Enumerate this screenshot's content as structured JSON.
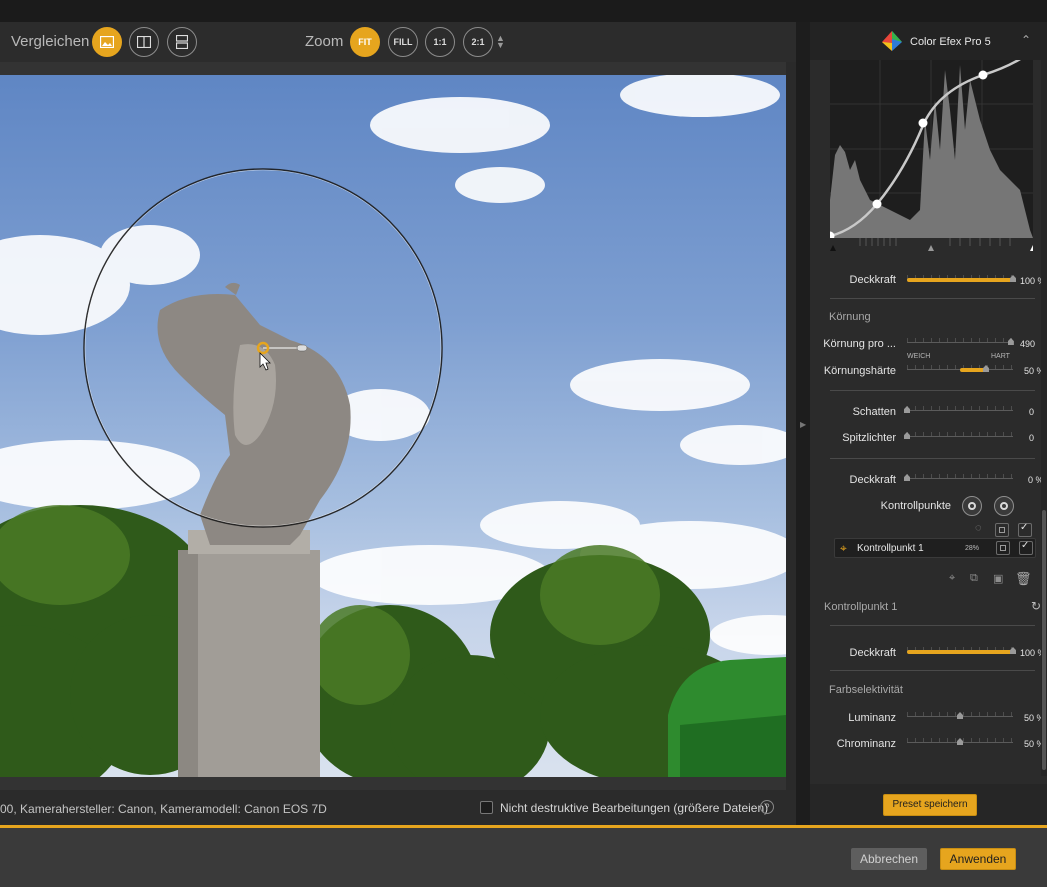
{
  "toolbar": {
    "compare_label": "Vergleichen",
    "zoom_label": "Zoom",
    "zoom_buttons": [
      "FIT",
      "FILL",
      "1:1",
      "2:1"
    ],
    "zoom_selected": "FIT"
  },
  "status": {
    "exif_text": "00, Kamerahersteller: Canon, Kameramodell: Canon EOS 7D",
    "nondestructive_label": "Nicht destruktive Bearbeitungen (größere Dateien)",
    "help": "?"
  },
  "panel": {
    "title": "Color Efex Pro 5",
    "opacity1": {
      "label": "Deckkraft",
      "value": "100",
      "unit": "%",
      "level": 1.0
    },
    "grain_section": "Körnung",
    "grain_per": {
      "label": "Körnung pro ...",
      "value": "490",
      "level": 0.98
    },
    "grain_soft": "WEICH",
    "grain_hard": "HART",
    "grain_hardness": {
      "label": "Körnungshärte",
      "value": "50",
      "unit": "%",
      "level": 0.5
    },
    "shadows": {
      "label": "Schatten",
      "value": "0",
      "level": 0.0
    },
    "highlights": {
      "label": "Spitzlichter",
      "value": "0",
      "level": 0.0
    },
    "opacity2": {
      "label": "Deckkraft",
      "value": "0",
      "unit": "%",
      "level": 0.0
    },
    "control_points_label": "Kontrollpunkte",
    "control_point_item": {
      "name": "Kontrollpunkt 1",
      "percent": "28%"
    },
    "cp_section": "Kontrollpunkt 1",
    "opacity3": {
      "label": "Deckkraft",
      "value": "100",
      "unit": "%",
      "level": 1.0
    },
    "color_sel_section": "Farbselektivität",
    "luminance": {
      "label": "Luminanz",
      "value": "50",
      "unit": "%",
      "level": 0.5
    },
    "chrominance": {
      "label": "Chrominanz",
      "value": "50",
      "unit": "%",
      "level": 0.5
    },
    "save_preset": "Preset speichern"
  },
  "footer": {
    "cancel": "Abbrechen",
    "apply": "Anwenden"
  },
  "colors": {
    "accent": "#e6a51e",
    "panel_bg": "#2b2b2b"
  }
}
